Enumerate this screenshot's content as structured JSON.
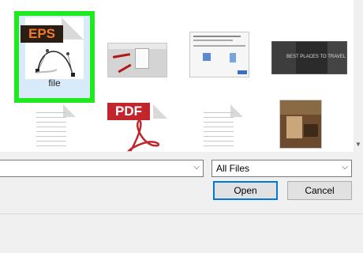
{
  "files": {
    "eps": {
      "badge": "EPS",
      "label": "file"
    },
    "pdf": {
      "badge": "PDF"
    },
    "photo_thumb": {
      "caption": "BEST PLACES TO TRAVEL"
    }
  },
  "dialog": {
    "filename_value": "",
    "filter_selected": "All Files",
    "open_label": "Open",
    "cancel_label": "Cancel"
  },
  "colors": {
    "selection_border": "#1eea1e",
    "eps_badge_text": "#f07a2b",
    "pdf_badge": "#c0262c",
    "default_button_border": "#0078d7"
  }
}
